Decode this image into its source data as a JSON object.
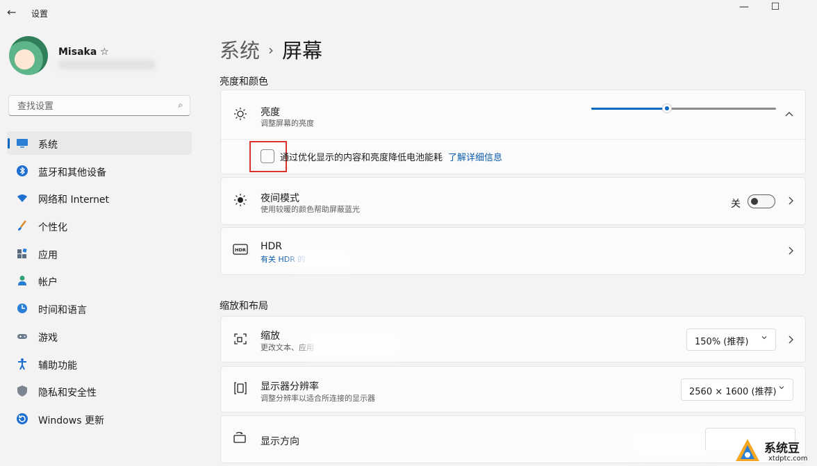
{
  "window": {
    "title": "设置",
    "back_glyph": "←",
    "minimize_glyph": "—",
    "maximize_glyph": "☐",
    "accent_color": "#0067c0"
  },
  "profile": {
    "name": "Misaka ☆"
  },
  "search": {
    "placeholder": "查找设置",
    "icon": "search-icon"
  },
  "sidebar": {
    "items": [
      {
        "label": "系统",
        "icon": "display-icon",
        "selected": true
      },
      {
        "label": "蓝牙和其他设备",
        "icon": "bluetooth-icon"
      },
      {
        "label": "网络和 Internet",
        "icon": "wifi-icon"
      },
      {
        "label": "个性化",
        "icon": "brush-icon"
      },
      {
        "label": "应用",
        "icon": "apps-icon"
      },
      {
        "label": "帐户",
        "icon": "person-icon"
      },
      {
        "label": "时间和语言",
        "icon": "globe-clock-icon"
      },
      {
        "label": "游戏",
        "icon": "gamepad-icon"
      },
      {
        "label": "辅助功能",
        "icon": "accessibility-icon"
      },
      {
        "label": "隐私和安全性",
        "icon": "shield-icon"
      },
      {
        "label": "Windows 更新",
        "icon": "update-icon"
      }
    ]
  },
  "breadcrumb": {
    "parent": "系统",
    "separator": "›",
    "current": "屏幕"
  },
  "sections": {
    "brightness_color": "亮度和颜色",
    "scale_layout": "缩放和布局"
  },
  "brightness": {
    "title": "亮度",
    "description": "调整屏幕的亮度",
    "value_fraction": 0.41,
    "chevron": "⌃"
  },
  "battery_option": {
    "label": "通过优化显示的内容和亮度降低电池能耗",
    "link": "了解详细信息",
    "checked": false
  },
  "night_light": {
    "title": "夜间模式",
    "description": "使用较暖的颜色帮助屏蔽蓝光",
    "state_label": "关",
    "on": false
  },
  "hdr": {
    "title": "HDR",
    "description": "有关 HDR 的",
    "icon_text": "HDR"
  },
  "scale": {
    "title": "缩放",
    "description": "更改文本、应用",
    "value": "150% (推荐)"
  },
  "resolution": {
    "title": "显示器分辨率",
    "description": "调整分辨率以适合所连接的显示器",
    "value": "2560 × 1600 (推荐)"
  },
  "orientation": {
    "title": "显示方向"
  },
  "watermark": {
    "name": "系统豆",
    "url": "xtdptc.com"
  }
}
